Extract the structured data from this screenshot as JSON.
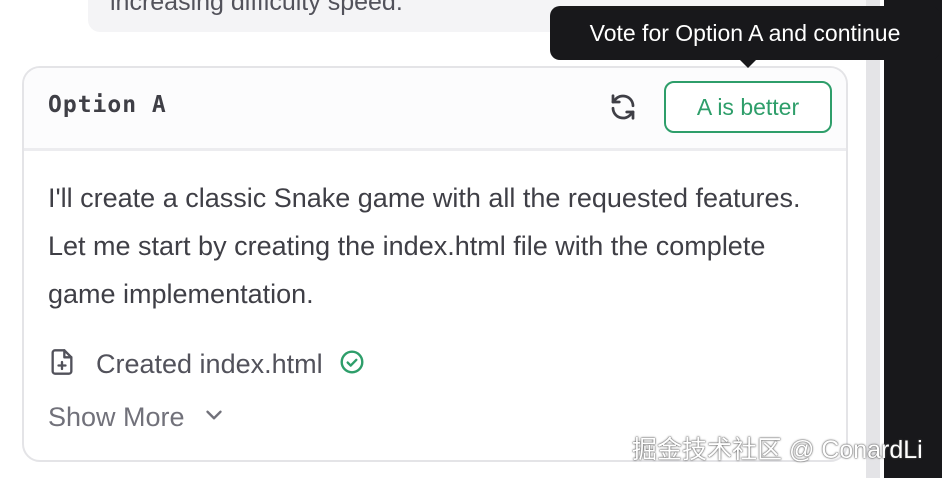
{
  "previous_message": {
    "text": "increasing difficulty speed."
  },
  "tooltip": {
    "text": "Vote for Option A and continue"
  },
  "option_card": {
    "title": "Option A",
    "refresh_icon": "refresh-icon",
    "vote_label": "A is better",
    "body": "I'll create a classic Snake game with all the requested features. Let me start by creating the index.html file with the complete game implementation.",
    "file_action": {
      "label": "Created index.html",
      "icon": "file-plus-icon",
      "status_icon": "check-circle-icon"
    },
    "show_more_label": "Show More"
  },
  "watermark": "掘金技术社区 @ ConardLi",
  "colors": {
    "accent_green": "#2e9e6a",
    "tooltip_bg": "#18181b",
    "text": "#3f3f46",
    "muted": "#71717a"
  }
}
